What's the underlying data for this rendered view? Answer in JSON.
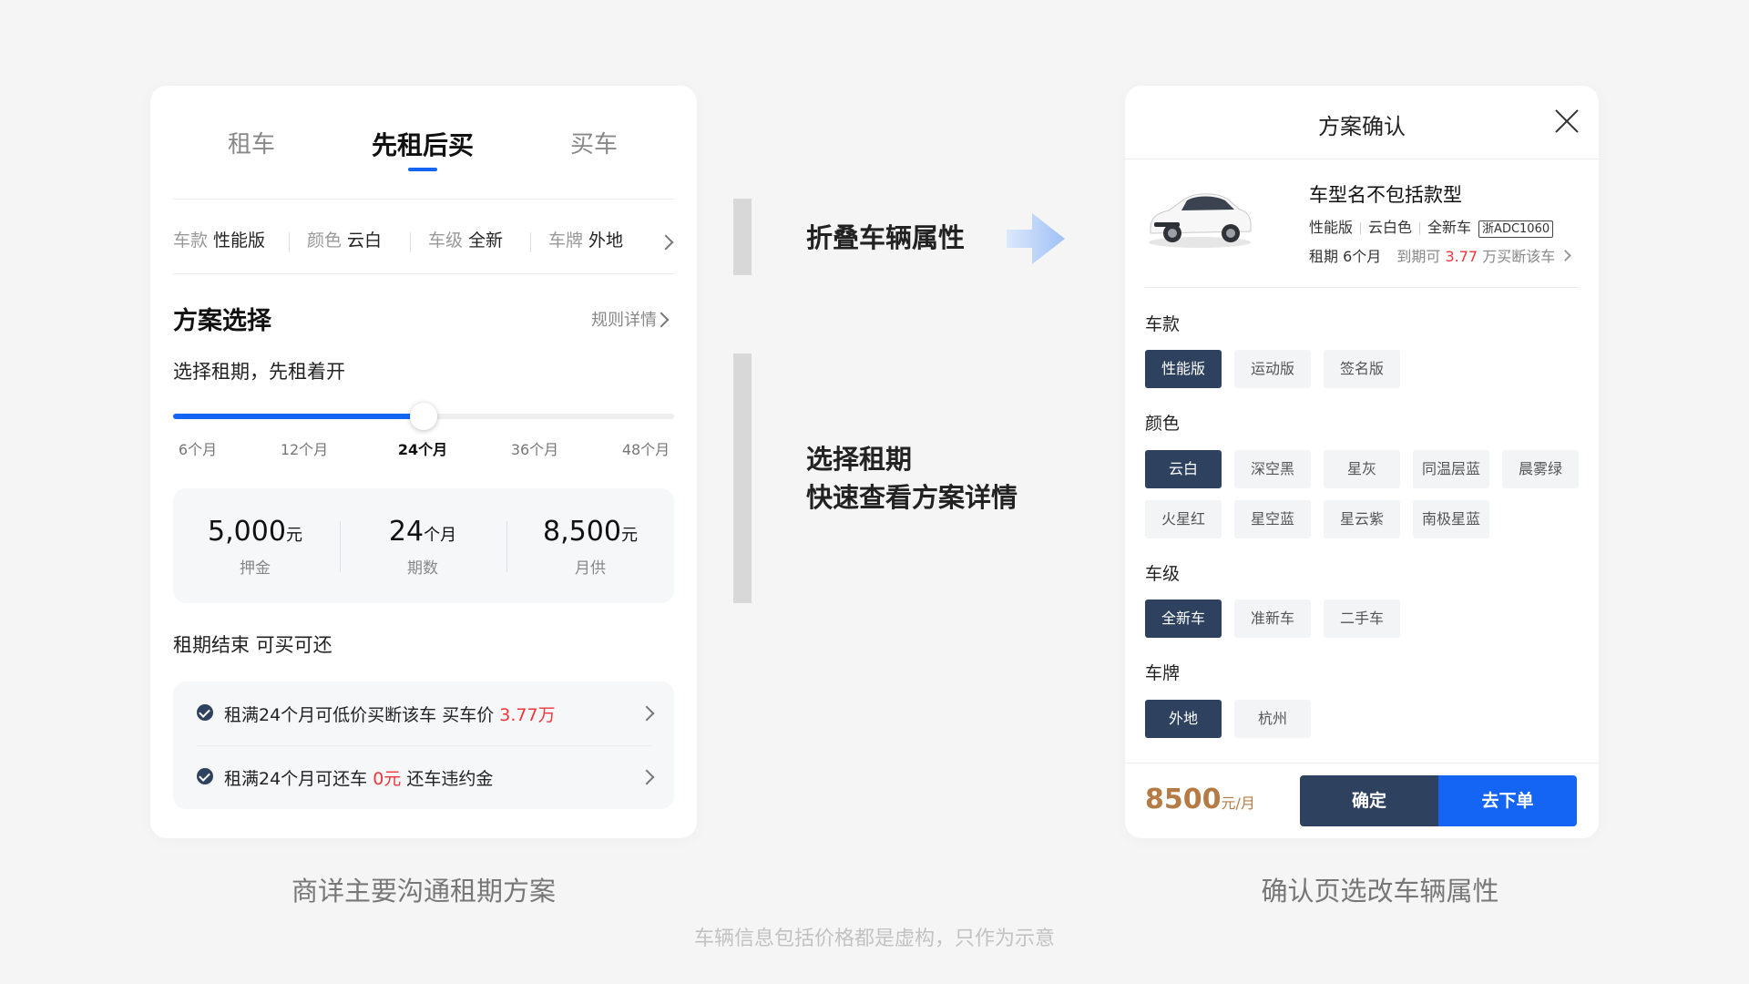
{
  "left_card": {
    "tabs": [
      "租车",
      "先租后买",
      "买车"
    ],
    "active_tab": "先租后买",
    "attributes": [
      {
        "key": "车款",
        "value": "性能版"
      },
      {
        "key": "颜色",
        "value": "云白"
      },
      {
        "key": "车级",
        "value": "全新"
      },
      {
        "key": "车牌",
        "value": "外地"
      }
    ],
    "section_title": "方案选择",
    "rule_link": "规则详情",
    "subtitle": "选择租期，先租着开",
    "slider": {
      "ticks": [
        "6个月",
        "12个月",
        "24个月",
        "36个月",
        "48个月"
      ],
      "selected": "24个月",
      "fill_fraction": 0.5
    },
    "stats": [
      {
        "number": "5,000",
        "unit": "元",
        "label": "押金"
      },
      {
        "number": "24",
        "unit": "个月",
        "label": "期数"
      },
      {
        "number": "8,500",
        "unit": "元",
        "label": "月供"
      }
    ],
    "end_title": "租期结束 可买可还",
    "benefits": [
      {
        "prefix": "租满24个月可低价买断该车 买车价 ",
        "highlight": "3.77万",
        "suffix": ""
      },
      {
        "prefix": "租满24个月可还车 ",
        "highlight": "0元",
        "suffix": " 还车违约金"
      }
    ]
  },
  "annotations": {
    "fold": "折叠车辆属性",
    "select_line1": "选择租期",
    "select_line2": "快速查看方案详情"
  },
  "right_card": {
    "title": "方案确认",
    "car_name": "车型名不包括款型",
    "car_tags": [
      "性能版",
      "云白色",
      "全新车"
    ],
    "plate": "浙ADC1060",
    "term_label": "租期 6个月",
    "term_hint": "到期可",
    "term_price": "3.77",
    "term_suffix": "万买断该车",
    "groups": [
      {
        "label": "车款",
        "options": [
          "性能版",
          "运动版",
          "签名版"
        ],
        "selected": "性能版"
      },
      {
        "label": "颜色",
        "options": [
          "云白",
          "深空黑",
          "星灰",
          "同温层蓝",
          "晨雾绿",
          "火星红",
          "星空蓝",
          "星云紫",
          "南极星蓝"
        ],
        "selected": "云白"
      },
      {
        "label": "车级",
        "options": [
          "全新车",
          "准新车",
          "二手车"
        ],
        "selected": "全新车"
      },
      {
        "label": "车牌",
        "options": [
          "外地",
          "杭州"
        ],
        "selected": "外地"
      }
    ],
    "price": "8500",
    "price_unit": "元/月",
    "confirm_label": "确定",
    "order_label": "去下单"
  },
  "captions": {
    "left": "商详主要沟通租期方案",
    "right": "确认页选改车辆属性",
    "disclaimer": "车辆信息包括价格都是虚构，只作为示意"
  },
  "colors": {
    "primary_blue": "#1565f5",
    "navy": "#2e4260",
    "price_brown": "#b57b45",
    "highlight_red": "#f0363a"
  }
}
